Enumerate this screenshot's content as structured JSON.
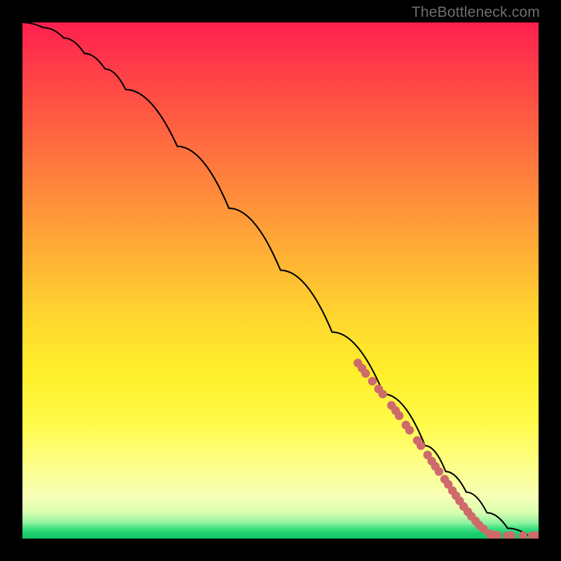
{
  "watermark": "TheBottleneck.com",
  "chart_data": {
    "type": "line",
    "title": "",
    "xlabel": "",
    "ylabel": "",
    "xlim": [
      0,
      100
    ],
    "ylim": [
      0,
      100
    ],
    "grid": false,
    "legend": false,
    "series": [
      {
        "name": "curve",
        "style": "line",
        "color": "#000000",
        "x": [
          0,
          4,
          8,
          12,
          16,
          20,
          30,
          40,
          50,
          60,
          70,
          78,
          82,
          86,
          90,
          94,
          98,
          100
        ],
        "y": [
          100,
          99,
          97,
          94,
          91,
          87,
          76,
          64,
          52,
          40,
          28,
          18,
          13,
          9,
          5,
          2,
          0.6,
          0.5
        ]
      },
      {
        "name": "dots",
        "style": "scatter",
        "color": "#cf6a6a",
        "points": [
          {
            "x": 65.0,
            "y": 34.0
          },
          {
            "x": 65.8,
            "y": 33.0
          },
          {
            "x": 66.5,
            "y": 32.0
          },
          {
            "x": 67.8,
            "y": 30.5
          },
          {
            "x": 69.0,
            "y": 29.0
          },
          {
            "x": 69.8,
            "y": 28.0
          },
          {
            "x": 71.5,
            "y": 25.8
          },
          {
            "x": 72.3,
            "y": 24.8
          },
          {
            "x": 73.0,
            "y": 23.8
          },
          {
            "x": 74.3,
            "y": 22.0
          },
          {
            "x": 75.0,
            "y": 21.0
          },
          {
            "x": 76.5,
            "y": 19.0
          },
          {
            "x": 77.2,
            "y": 18.0
          },
          {
            "x": 78.5,
            "y": 16.2
          },
          {
            "x": 79.3,
            "y": 15.0
          },
          {
            "x": 80.0,
            "y": 14.0
          },
          {
            "x": 80.7,
            "y": 13.0
          },
          {
            "x": 81.8,
            "y": 11.5
          },
          {
            "x": 82.5,
            "y": 10.5
          },
          {
            "x": 83.3,
            "y": 9.3
          },
          {
            "x": 84.0,
            "y": 8.3
          },
          {
            "x": 84.7,
            "y": 7.3
          },
          {
            "x": 85.5,
            "y": 6.2
          },
          {
            "x": 86.3,
            "y": 5.2
          },
          {
            "x": 87.0,
            "y": 4.3
          },
          {
            "x": 87.8,
            "y": 3.4
          },
          {
            "x": 88.5,
            "y": 2.6
          },
          {
            "x": 89.3,
            "y": 1.9
          },
          {
            "x": 90.5,
            "y": 0.9
          },
          {
            "x": 91.3,
            "y": 0.7
          },
          {
            "x": 92.0,
            "y": 0.6
          },
          {
            "x": 94.0,
            "y": 0.55
          },
          {
            "x": 94.7,
            "y": 0.55
          },
          {
            "x": 97.0,
            "y": 0.55
          },
          {
            "x": 98.8,
            "y": 0.55
          },
          {
            "x": 99.5,
            "y": 0.55
          }
        ]
      }
    ]
  }
}
